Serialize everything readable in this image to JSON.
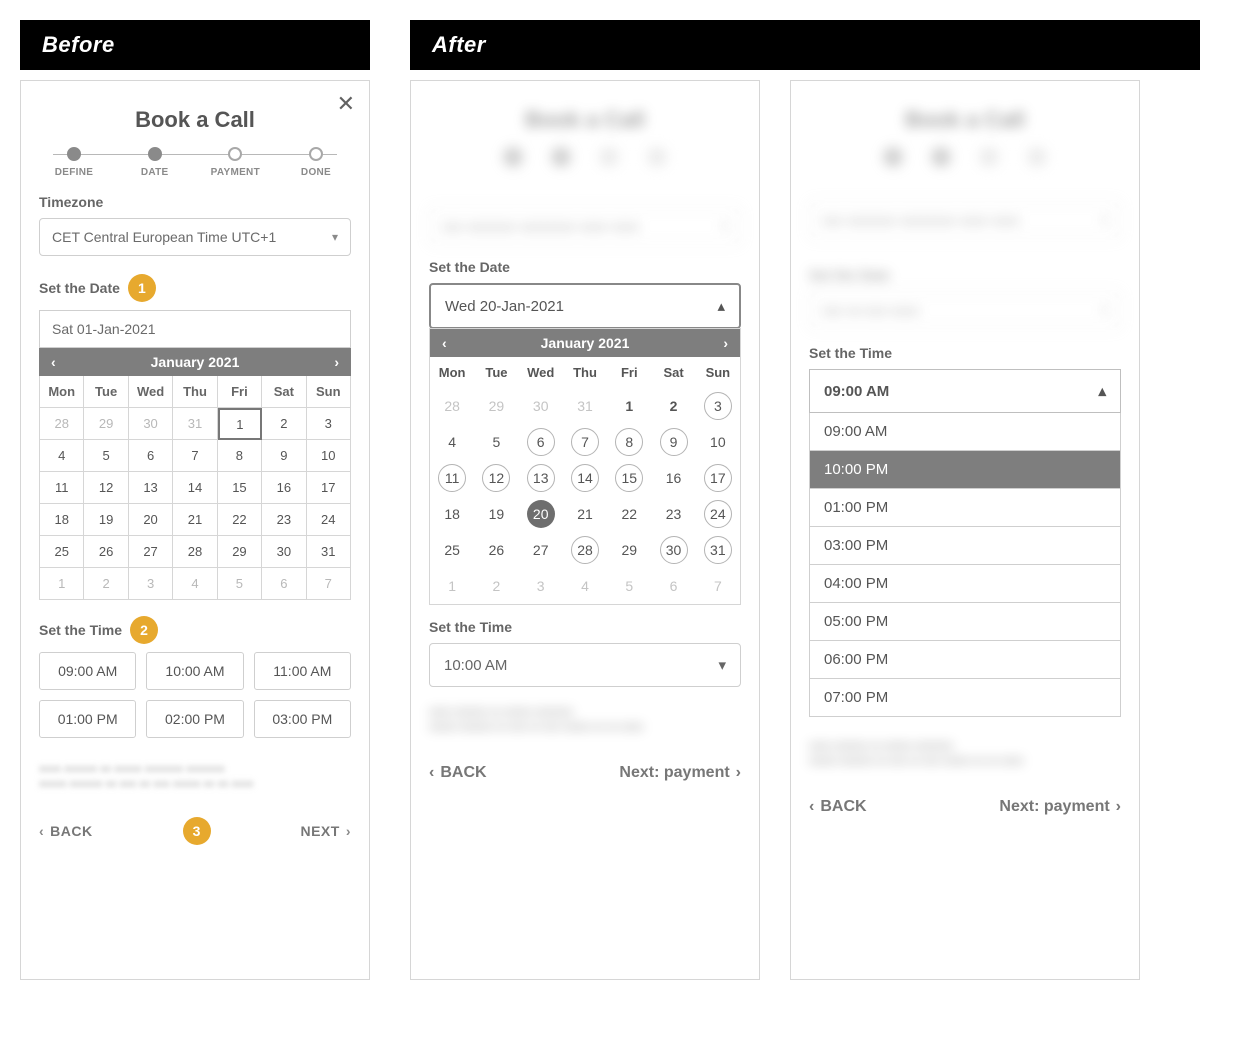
{
  "labels": {
    "before": "Before",
    "after": "After"
  },
  "before": {
    "title": "Book a Call",
    "steps": [
      "DEFINE",
      "DATE",
      "PAYMENT",
      "DONE"
    ],
    "timezone_label": "Timezone",
    "timezone_value": "CET Central European Time UTC+1",
    "set_date_label": "Set the Date",
    "date_input": "Sat 01-Jan-2021",
    "cal_month": "January 2021",
    "dow": [
      "Mon",
      "Tue",
      "Wed",
      "Thu",
      "Fri",
      "Sat",
      "Sun"
    ],
    "weeks": [
      [
        {
          "d": "28",
          "m": true
        },
        {
          "d": "29",
          "m": true
        },
        {
          "d": "30",
          "m": true
        },
        {
          "d": "31",
          "m": true
        },
        {
          "d": "1",
          "sel": true
        },
        {
          "d": "2"
        },
        {
          "d": "3"
        }
      ],
      [
        {
          "d": "4"
        },
        {
          "d": "5"
        },
        {
          "d": "6"
        },
        {
          "d": "7"
        },
        {
          "d": "8"
        },
        {
          "d": "9"
        },
        {
          "d": "10"
        }
      ],
      [
        {
          "d": "11"
        },
        {
          "d": "12"
        },
        {
          "d": "13"
        },
        {
          "d": "14"
        },
        {
          "d": "15"
        },
        {
          "d": "16"
        },
        {
          "d": "17"
        }
      ],
      [
        {
          "d": "18"
        },
        {
          "d": "19"
        },
        {
          "d": "20"
        },
        {
          "d": "21"
        },
        {
          "d": "22"
        },
        {
          "d": "23"
        },
        {
          "d": "24"
        }
      ],
      [
        {
          "d": "25"
        },
        {
          "d": "26"
        },
        {
          "d": "27"
        },
        {
          "d": "28"
        },
        {
          "d": "29"
        },
        {
          "d": "30"
        },
        {
          "d": "31"
        }
      ],
      [
        {
          "d": "1",
          "m": true
        },
        {
          "d": "2",
          "m": true
        },
        {
          "d": "3",
          "m": true
        },
        {
          "d": "4",
          "m": true
        },
        {
          "d": "5",
          "m": true
        },
        {
          "d": "6",
          "m": true
        },
        {
          "d": "7",
          "m": true
        }
      ]
    ],
    "set_time_label": "Set the Time",
    "times": [
      "09:00 AM",
      "10:00 AM",
      "11:00 AM",
      "01:00 PM",
      "02:00 PM",
      "03:00 PM"
    ],
    "back": "BACK",
    "next": "NEXT",
    "badges": {
      "b1": "1",
      "b2": "2",
      "b3": "3"
    }
  },
  "after1": {
    "set_date_label": "Set the Date",
    "date_value": "Wed 20-Jan-2021",
    "cal_month": "January 2021",
    "dow": [
      "Mon",
      "Tue",
      "Wed",
      "Thu",
      "Fri",
      "Sat",
      "Sun"
    ],
    "weeks": [
      [
        {
          "d": "28",
          "m": true
        },
        {
          "d": "29",
          "m": true
        },
        {
          "d": "30",
          "m": true
        },
        {
          "d": "31",
          "m": true
        },
        {
          "d": "1",
          "b": true
        },
        {
          "d": "2",
          "b": true
        },
        {
          "d": "3",
          "c": true
        }
      ],
      [
        {
          "d": "4"
        },
        {
          "d": "5"
        },
        {
          "d": "6",
          "c": true
        },
        {
          "d": "7",
          "c": true
        },
        {
          "d": "8",
          "c": true
        },
        {
          "d": "9",
          "c": true
        },
        {
          "d": "10"
        }
      ],
      [
        {
          "d": "11",
          "c": true
        },
        {
          "d": "12",
          "c": true
        },
        {
          "d": "13",
          "c": true
        },
        {
          "d": "14",
          "c": true
        },
        {
          "d": "15",
          "c": true
        },
        {
          "d": "16"
        },
        {
          "d": "17",
          "c": true
        }
      ],
      [
        {
          "d": "18"
        },
        {
          "d": "19"
        },
        {
          "d": "20",
          "s": true
        },
        {
          "d": "21"
        },
        {
          "d": "22"
        },
        {
          "d": "23"
        },
        {
          "d": "24",
          "c": true
        }
      ],
      [
        {
          "d": "25"
        },
        {
          "d": "26"
        },
        {
          "d": "27"
        },
        {
          "d": "28",
          "c": true
        },
        {
          "d": "29"
        },
        {
          "d": "30",
          "c": true
        },
        {
          "d": "31",
          "c": true
        }
      ],
      [
        {
          "d": "1",
          "m": true
        },
        {
          "d": "2",
          "m": true
        },
        {
          "d": "3",
          "m": true
        },
        {
          "d": "4",
          "m": true
        },
        {
          "d": "5",
          "m": true
        },
        {
          "d": "6",
          "m": true
        },
        {
          "d": "7",
          "m": true
        }
      ]
    ],
    "set_time_label": "Set the Time",
    "time_value": "10:00 AM",
    "back": "BACK",
    "next": "Next: payment"
  },
  "after2": {
    "set_time_label": "Set the Time",
    "time_header": "09:00 AM",
    "options": [
      {
        "t": "09:00 AM"
      },
      {
        "t": "10:00 PM",
        "sel": true
      },
      {
        "t": "01:00 PM"
      },
      {
        "t": "03:00 PM"
      },
      {
        "t": "04:00 PM"
      },
      {
        "t": "05:00 PM"
      },
      {
        "t": "06:00 PM"
      },
      {
        "t": "07:00 PM"
      }
    ],
    "back": "BACK",
    "next": "Next: payment"
  }
}
